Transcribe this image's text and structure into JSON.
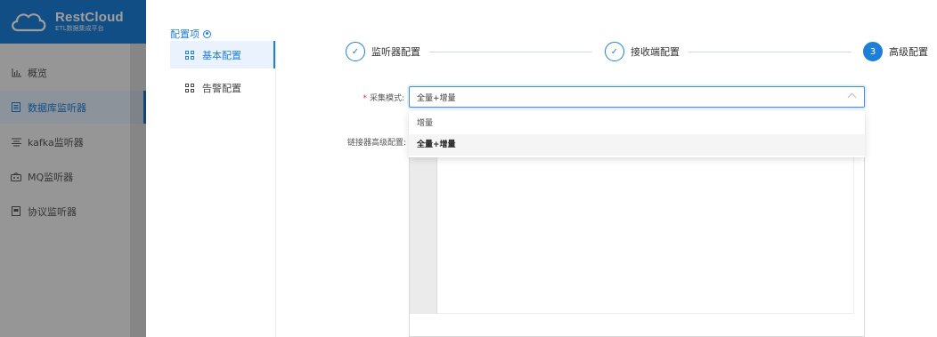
{
  "app": {
    "logo_title": "RestCloud",
    "logo_subtitle": "ETL数据集成平台",
    "brand_color": "#1e7fd8"
  },
  "sidebar": {
    "items": [
      {
        "label": "概览",
        "icon": "chart-icon",
        "active": false
      },
      {
        "label": "数据库监听器",
        "icon": "database-icon",
        "active": true
      },
      {
        "label": "kafka监听器",
        "icon": "list-icon",
        "active": false
      },
      {
        "label": "MQ监听器",
        "icon": "mq-icon",
        "active": false
      },
      {
        "label": "协议监听器",
        "icon": "document-icon",
        "active": false
      }
    ]
  },
  "config": {
    "title": "配置项",
    "items": [
      {
        "label": "基本配置",
        "active": true
      },
      {
        "label": "告警配置",
        "active": false
      }
    ]
  },
  "steps": [
    {
      "label": "监听器配置",
      "status": "done",
      "marker": "✓"
    },
    {
      "label": "接收端配置",
      "status": "done",
      "marker": "✓"
    },
    {
      "label": "高级配置",
      "status": "current",
      "marker": "3"
    }
  ],
  "form": {
    "collect_mode": {
      "label": "采集模式:",
      "required": true,
      "value": "全量+增量",
      "options": [
        "增量",
        "全量+增量"
      ],
      "selected_option": "全量+增量"
    },
    "connector_config": {
      "label": "链接器高级配置:",
      "value": ""
    }
  }
}
